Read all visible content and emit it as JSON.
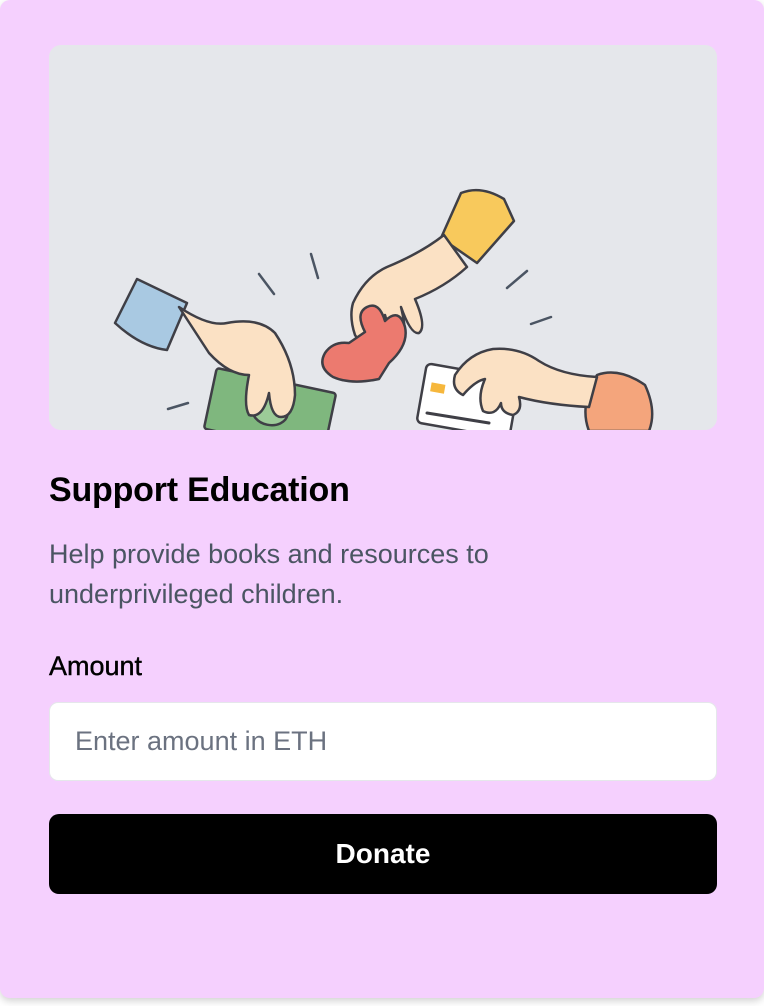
{
  "card": {
    "background_color": "#f5d0fe",
    "illustration": {
      "icon": "hands-giving-money-heart-card-illustration",
      "background_color": "#e5e7eb"
    },
    "title": "Support Education",
    "description": "Help provide books and resources to underprivileged children.",
    "amount_label": "Amount",
    "amount_input": {
      "placeholder": "Enter amount in ETH",
      "value": ""
    },
    "donate_button": {
      "label": "Donate",
      "background_color": "#000000",
      "text_color": "#ffffff"
    }
  }
}
